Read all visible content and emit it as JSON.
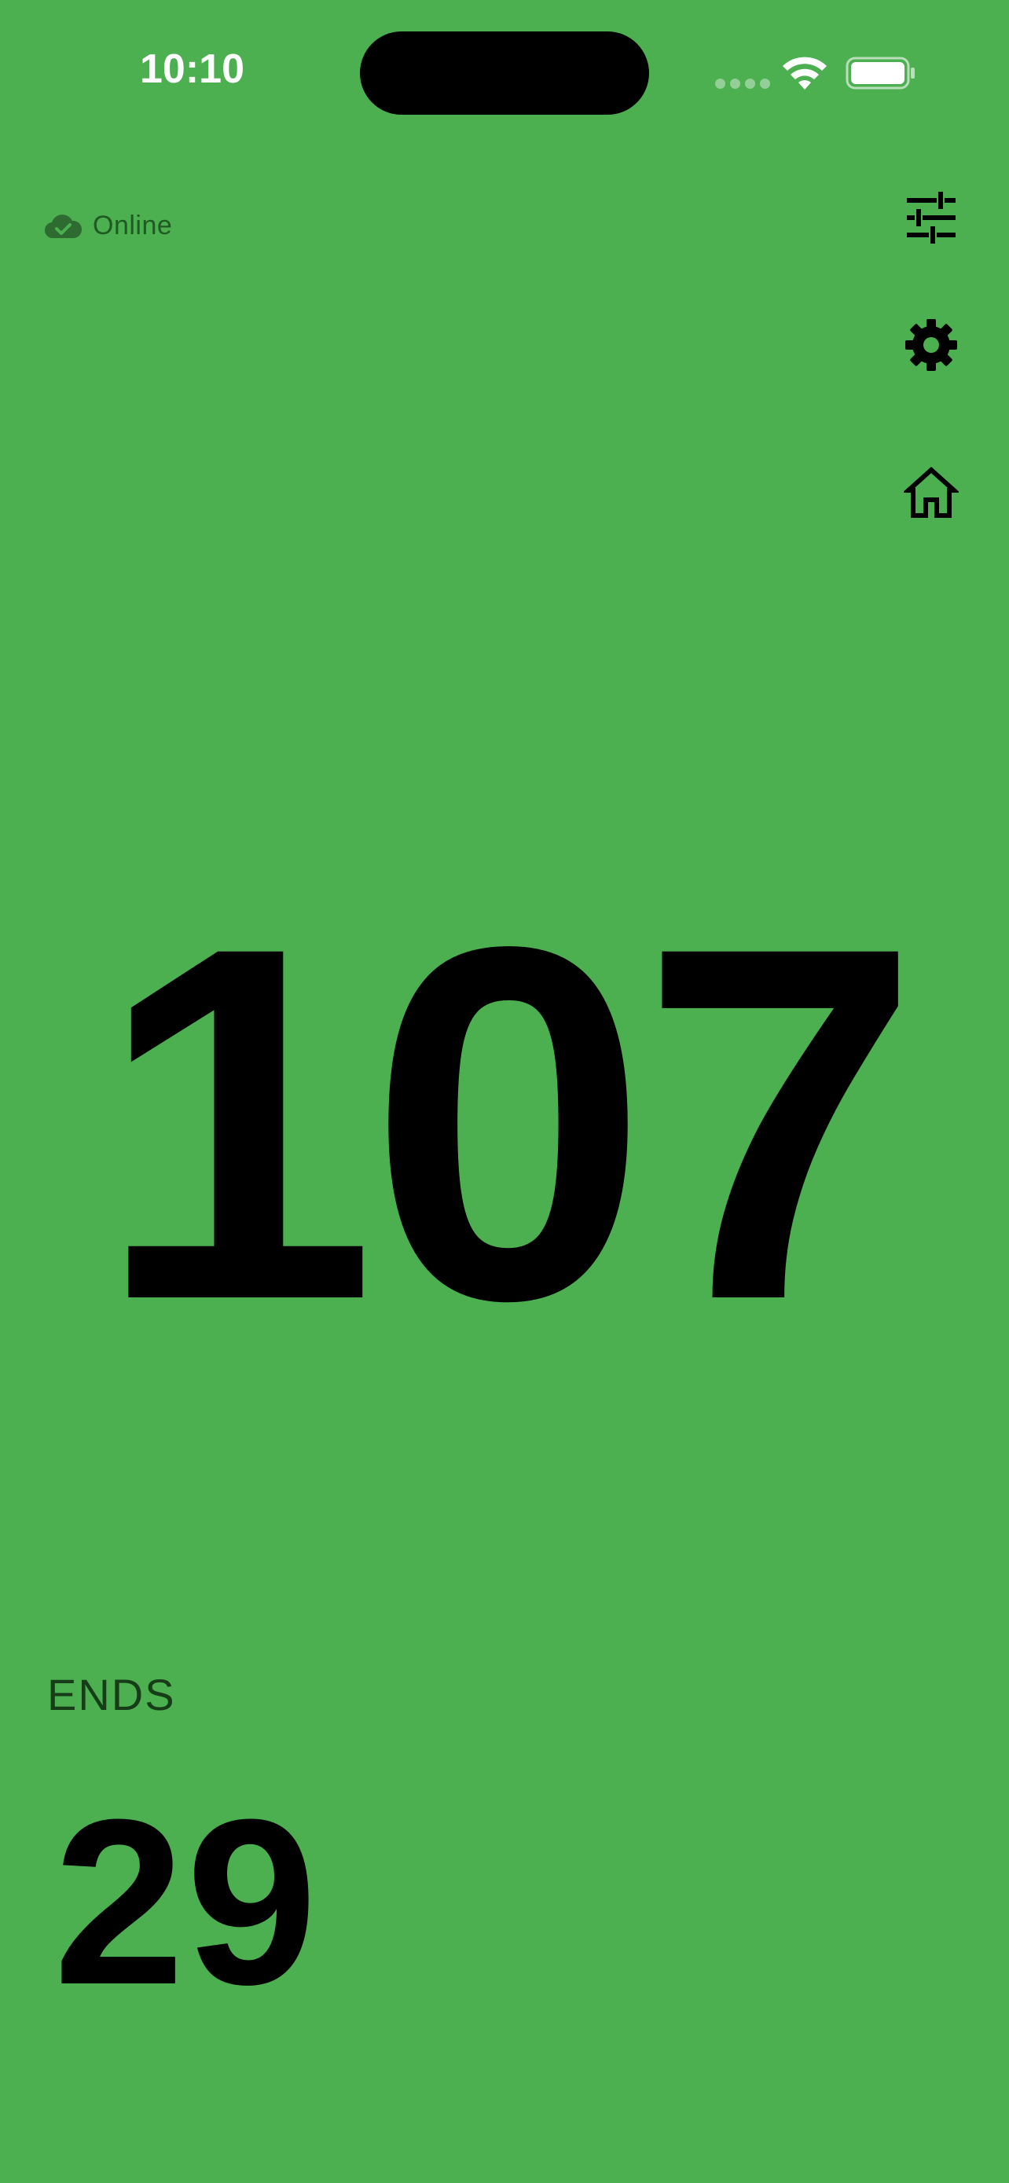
{
  "status_bar": {
    "time": "10:10"
  },
  "connection": {
    "label": "Online",
    "icon": "cloud-check-icon",
    "color": "#1f5a22"
  },
  "side_buttons": [
    {
      "name": "filter-button",
      "icon": "tune-sliders-icon"
    },
    {
      "name": "settings-button",
      "icon": "gear-icon"
    },
    {
      "name": "home-button",
      "icon": "home-icon"
    }
  ],
  "counter": {
    "value": "107"
  },
  "ends": {
    "label": "ENDS",
    "value": "29"
  },
  "colors": {
    "background": "#4caf50",
    "text": "#000000"
  }
}
